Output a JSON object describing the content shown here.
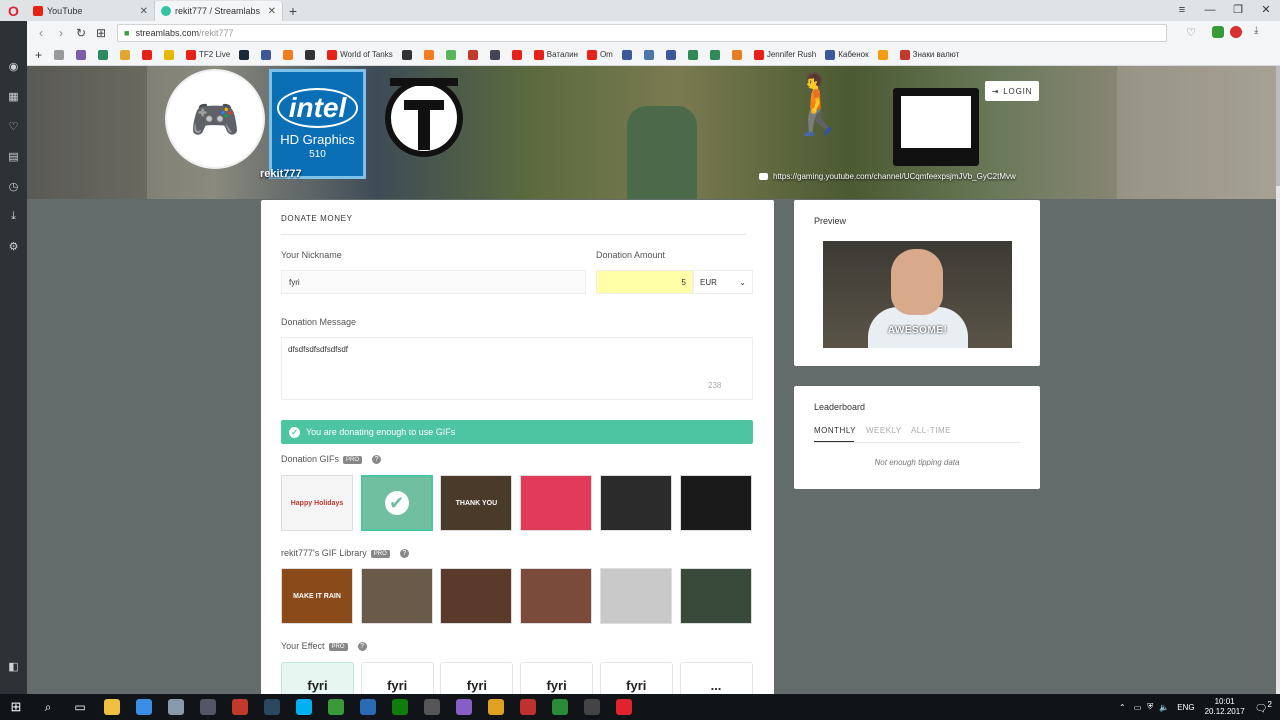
{
  "browser": {
    "tabs": [
      {
        "title": "YouTube",
        "active": false
      },
      {
        "title": "rekit777 / Streamlabs",
        "active": true
      }
    ],
    "url": {
      "host": "streamlabs.com",
      "path": "/rekit777"
    },
    "bookmarks": [
      {
        "label": "",
        "color": "#999"
      },
      {
        "label": "",
        "color": "#7b5ea7"
      },
      {
        "label": "",
        "color": "#2b8a5e"
      },
      {
        "label": "",
        "color": "#e0a72e"
      },
      {
        "label": "",
        "color": "#e62117"
      },
      {
        "label": "",
        "color": "#e6b800"
      },
      {
        "label": "TF2 Live",
        "color": "#e62117"
      },
      {
        "label": "",
        "color": "#1b2838"
      },
      {
        "label": "",
        "color": "#3b5998"
      },
      {
        "label": "",
        "color": "#f47b20"
      },
      {
        "label": "",
        "color": "#333"
      },
      {
        "label": "World of Tanks",
        "color": "#e62117"
      },
      {
        "label": "",
        "color": "#333"
      },
      {
        "label": "",
        "color": "#f47b20"
      },
      {
        "label": "",
        "color": "#5ab55a"
      },
      {
        "label": "",
        "color": "#c0392b"
      },
      {
        "label": "",
        "color": "#445"
      },
      {
        "label": "",
        "color": "#e62117"
      },
      {
        "label": "Ваталин",
        "color": "#e62117"
      },
      {
        "label": "Om",
        "color": "#e62117"
      },
      {
        "label": "",
        "color": "#3b5998"
      },
      {
        "label": "",
        "color": "#4a76a8"
      },
      {
        "label": "",
        "color": "#3b5998"
      },
      {
        "label": "",
        "color": "#2e8b57"
      },
      {
        "label": "",
        "color": "#2e8b57"
      },
      {
        "label": "",
        "color": "#e67e22"
      },
      {
        "label": "Jennifer Rush",
        "color": "#e62117"
      },
      {
        "label": "Кабенок",
        "color": "#3b5998"
      },
      {
        "label": "",
        "color": "#f39c12"
      },
      {
        "label": "Знаки валют",
        "color": "#c0392b"
      }
    ],
    "window_controls": [
      "≡",
      "—",
      "❐",
      "✕"
    ]
  },
  "sidebar": {
    "icons": [
      "camera-icon",
      "grid-icon",
      "heart-icon",
      "news-icon",
      "history-icon",
      "download-icon",
      "gear-icon",
      "panel-icon"
    ]
  },
  "banner": {
    "username": "rekit777",
    "login_label": "LOGIN",
    "channel_url": "https://gaming.youtube.com/channel/UCqmfeexpsjmJVb_GyC2tMvw",
    "intel": {
      "brand": "intel",
      "line1": "HD Graphics",
      "line2": "510"
    }
  },
  "donate": {
    "section_title": "DONATE MONEY",
    "nickname_label": "Your Nickname",
    "nickname_value": "fyri",
    "amount_label": "Donation Amount",
    "amount_value": "5",
    "currency": "EUR",
    "message_label": "Donation Message",
    "message_value": "dfsdfsdfsdfsdfsdf",
    "char_counter": "238",
    "notice": "You are donating enough to use GIFs",
    "gifs_label": "Donation GIFs",
    "pro_badge": "PRO",
    "gifs": [
      {
        "name": "happy-holidays-gif",
        "caption": "Happy Holidays",
        "bg": "#f5f5f5",
        "color": "#c0392b"
      },
      {
        "name": "selected-gif",
        "caption": "",
        "bg": "#6fbfa0",
        "color": "#fff"
      },
      {
        "name": "thank-you-gif",
        "caption": "THANK YOU",
        "bg": "#4a3a2a",
        "color": "#fff"
      },
      {
        "name": "heart-gif",
        "caption": "",
        "bg": "#e23b5a",
        "color": "#f9c74f"
      },
      {
        "name": "man-gif",
        "caption": "",
        "bg": "#2b2b2b",
        "color": "#fff"
      },
      {
        "name": "cloud-gif",
        "caption": "",
        "bg": "#1a1a1a",
        "color": "#8bc34a"
      }
    ],
    "library_label": "rekit777's GIF Library",
    "library": [
      {
        "name": "make-it-rain-gif",
        "caption": "MAKE IT RAIN",
        "bg": "#8a4a1a"
      },
      {
        "name": "wolf-man-gif",
        "caption": "",
        "bg": "#6a5a4a"
      },
      {
        "name": "hands-gif",
        "caption": "",
        "bg": "#5a3a2a"
      },
      {
        "name": "fire-dance-gif",
        "caption": "",
        "bg": "#7a4a3a"
      },
      {
        "name": "light-gif",
        "caption": "",
        "bg": "#c8c8c8"
      },
      {
        "name": "sunglasses-gif",
        "caption": "",
        "bg": "#3a4a3a"
      }
    ],
    "effect_label": "Your Effect",
    "effects": [
      "fyri",
      "fyri",
      "fyri",
      "fyri",
      "fyri",
      "..."
    ]
  },
  "preview": {
    "title": "Preview",
    "caption": "AWESOME!"
  },
  "leaderboard": {
    "title": "Leaderboard",
    "tabs": [
      "MONTHLY",
      "WEEKLY",
      "ALL-TIME"
    ],
    "active_tab": "MONTHLY",
    "empty_text": "Not enough tipping data"
  },
  "taskbar": {
    "lang": "ENG",
    "time": "10:01",
    "date": "20.12.2017",
    "notif_count": "2",
    "apps": [
      {
        "name": "file-explorer",
        "color": "#f0c040"
      },
      {
        "name": "browser-globe",
        "color": "#3a8ee6"
      },
      {
        "name": "app-gray",
        "color": "#8899aa"
      },
      {
        "name": "app-circle",
        "color": "#556"
      },
      {
        "name": "app-red",
        "color": "#c0392b"
      },
      {
        "name": "steam",
        "color": "#2a475e"
      },
      {
        "name": "skype",
        "color": "#00aff0"
      },
      {
        "name": "app-64",
        "color": "#3a9a3a"
      },
      {
        "name": "app-blue",
        "color": "#2a6ab5"
      },
      {
        "name": "app-xbox",
        "color": "#107c10"
      },
      {
        "name": "app-film",
        "color": "#555"
      },
      {
        "name": "visual-studio",
        "color": "#865fc5"
      },
      {
        "name": "app-orange",
        "color": "#e0a020"
      },
      {
        "name": "app-download",
        "color": "#c03030"
      },
      {
        "name": "app-wot",
        "color": "#2a8a3a"
      },
      {
        "name": "app-wot2",
        "color": "#444"
      },
      {
        "name": "opera",
        "color": "#e0232e"
      }
    ]
  }
}
